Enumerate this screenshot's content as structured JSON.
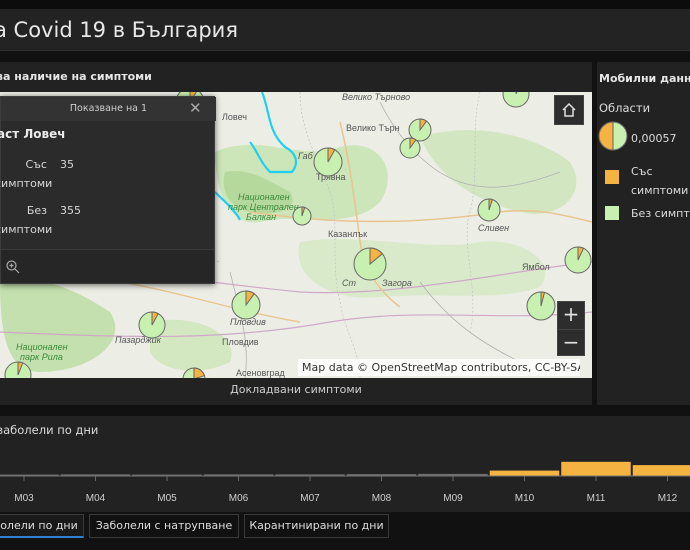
{
  "header": {
    "title": "a Covid 19 в България"
  },
  "map_panel": {
    "title": "ва наличие на симптоми",
    "caption": "Докладвани симптоми",
    "attribution": "Map data © OpenStreetMap contributors, CC-BY-SA",
    "places": [
      {
        "name": "Велико Търново",
        "italic": true
      },
      {
        "name": "Велико Търн",
        "italic": false
      },
      {
        "name": "Ловеч",
        "italic": false
      },
      {
        "name": "Габ",
        "italic": true
      },
      {
        "name": "Трявна",
        "italic": false
      },
      {
        "name": "Национален",
        "italic": true
      },
      {
        "name": "парк Централен",
        "italic": true
      },
      {
        "name": "Балкан",
        "italic": true
      },
      {
        "name": "Казанлък",
        "italic": false
      },
      {
        "name": "Сливен",
        "italic": true
      },
      {
        "name": "Ямбол",
        "italic": false
      },
      {
        "name": "Ст",
        "italic": true
      },
      {
        "name": "Загора",
        "italic": true
      },
      {
        "name": "Пловдив",
        "italic": true
      },
      {
        "name": "Пловдив",
        "italic": false
      },
      {
        "name": "Пазарджик",
        "italic": true
      },
      {
        "name": "Национален",
        "italic": true
      },
      {
        "name": "парк Рила",
        "italic": true
      },
      {
        "name": "Асеновград",
        "italic": false
      }
    ],
    "pies": [
      {
        "with": 35,
        "without": 355
      },
      {
        "with": 6,
        "without": 94
      },
      {
        "with": 10,
        "without": 90
      },
      {
        "with": 8,
        "without": 92
      },
      {
        "with": 5,
        "without": 95
      },
      {
        "with": 10,
        "without": 90
      },
      {
        "with": 7,
        "without": 93
      },
      {
        "with": 14,
        "without": 86
      },
      {
        "with": 10,
        "without": 90
      },
      {
        "with": 8,
        "without": 92
      },
      {
        "with": 4,
        "without": 96
      },
      {
        "with": 6,
        "without": 94
      },
      {
        "with": 20,
        "without": 80
      },
      {
        "with": 10,
        "without": 90
      },
      {
        "with": 5,
        "without": 95
      }
    ]
  },
  "popup": {
    "header": "Показване на 1",
    "title": "аст Ловеч",
    "row1_label": "Със симптоми",
    "row1_value": "35",
    "row2_label": "Без симптоми",
    "row2_value": "355"
  },
  "legend": {
    "title": "Мобилни данни",
    "subtitle": "Области",
    "value": "0,00057",
    "item1": "Със симптоми",
    "item2": "Без симптоми",
    "color_with": "#f5b342",
    "color_without": "#c8f0b0"
  },
  "chart_data": {
    "type": "bar",
    "title": "заболели по дни",
    "xlabel": "",
    "ylabel": "",
    "categories": [
      "M03",
      "M04",
      "M05",
      "M06",
      "M07",
      "M08",
      "M09",
      "M10",
      "M11",
      "M12"
    ],
    "series": [
      {
        "values": [
          2,
          3,
          2,
          3,
          3,
          4,
          5,
          20,
          60,
          45
        ]
      }
    ],
    "ylim": [
      0,
      100
    ]
  },
  "tabs": [
    {
      "label": "олели по дни",
      "active": true
    },
    {
      "label": "Заболели с натрупване",
      "active": false
    },
    {
      "label": "Карантинирани по дни",
      "active": false
    }
  ]
}
